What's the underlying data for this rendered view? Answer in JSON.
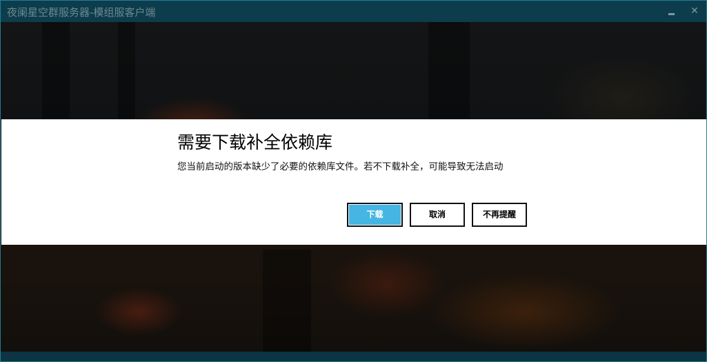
{
  "window": {
    "title": "夜阑星空群服务器-模组服客户端",
    "minimize_glyph": "▬",
    "close_glyph": "✕"
  },
  "dialog": {
    "title": "需要下载补全依赖库",
    "message": "您当前启动的版本缺少了必要的依赖库文件。若不下载补全，可能导致无法启动",
    "buttons": {
      "download": "下载",
      "cancel": "取消",
      "no_remind": "不再提醒"
    }
  },
  "colors": {
    "titlebar": "#0d3d4c",
    "accent_button": "#45b5e4",
    "dialog_bg": "#ffffff"
  },
  "icons": {
    "minimize": "minimize-icon",
    "close": "close-icon"
  }
}
